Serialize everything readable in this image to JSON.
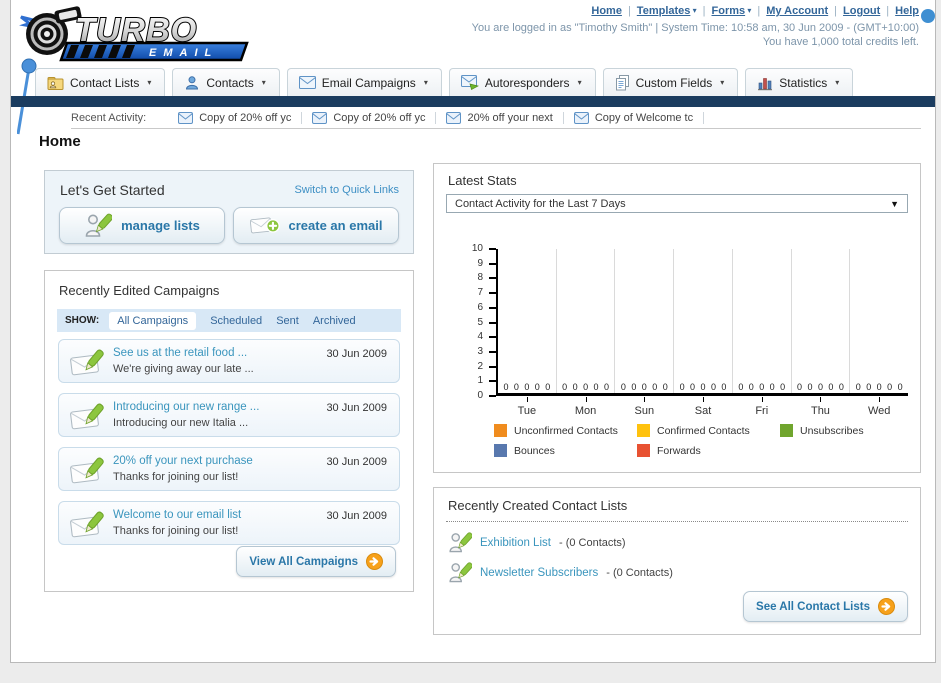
{
  "colors": {
    "navy_bar": "#1b3c5f",
    "link_blue": "#336699",
    "teal_link": "#3a95bd",
    "accent_orange": "#f7a11a"
  },
  "header": {
    "logo_title": "TURBO",
    "logo_subtitle": "EMAIL",
    "nav_links": [
      {
        "label": "Home",
        "caret": false
      },
      {
        "label": "Templates",
        "caret": true
      },
      {
        "label": "Forms",
        "caret": true
      },
      {
        "label": "My Account",
        "caret": false
      },
      {
        "label": "Logout",
        "caret": false
      },
      {
        "label": "Help",
        "caret": false
      }
    ],
    "login_line": "You are logged in as \"Timothy Smith\" | System Time: 10:58 am, 30 Jun 2009 - (GMT+10:00)",
    "credits_line": "You have 1,000 total credits left."
  },
  "tabs": [
    {
      "label": "Contact Lists",
      "icon": "contact-lists-icon"
    },
    {
      "label": "Contacts",
      "icon": "contacts-icon"
    },
    {
      "label": "Email Campaigns",
      "icon": "email-campaigns-icon"
    },
    {
      "label": "Autoresponders",
      "icon": "autoresponders-icon"
    },
    {
      "label": "Custom Fields",
      "icon": "custom-fields-icon"
    },
    {
      "label": "Statistics",
      "icon": "statistics-icon"
    }
  ],
  "recent_activity": {
    "label": "Recent Activity:",
    "items": [
      "Copy of 20% off yc",
      "Copy of 20% off yc",
      "20% off your next",
      "Copy of Welcome tc"
    ]
  },
  "page_title": "Home",
  "get_started": {
    "title": "Let's Get Started",
    "switch_link": "Switch to Quick Links",
    "buttons": [
      {
        "label": "manage lists",
        "icon": "person-pencil-icon"
      },
      {
        "label": "create an email",
        "icon": "envelope-plus-icon"
      }
    ]
  },
  "campaigns": {
    "title": "Recently Edited Campaigns",
    "show_label": "SHOW:",
    "filters": [
      "All Campaigns",
      "Scheduled",
      "Sent",
      "Archived"
    ],
    "active_filter": "All Campaigns",
    "items": [
      {
        "title": "See us at the retail food ...",
        "subtitle": "We're giving away our late ...",
        "date": "30 Jun 2009"
      },
      {
        "title": "Introducing our new range ...",
        "subtitle": "Introducing our new Italia ...",
        "date": "30 Jun 2009"
      },
      {
        "title": "20% off your next purchase",
        "subtitle": "Thanks for joining our list!",
        "date": "30 Jun 2009"
      },
      {
        "title": "Welcome to our email list",
        "subtitle": "Thanks for joining our list!",
        "date": "30 Jun 2009"
      }
    ],
    "view_all_label": "View All Campaigns"
  },
  "latest_stats": {
    "title": "Latest Stats",
    "dropdown_value": "Contact Activity for the Last 7 Days",
    "chart_data": {
      "type": "bar",
      "title": "Contact Activity for the Last 7 Days",
      "categories": [
        "Tue",
        "Mon",
        "Sun",
        "Sat",
        "Fri",
        "Thu",
        "Wed"
      ],
      "series": [
        {
          "name": "Unconfirmed Contacts",
          "color": "#F08C1E",
          "values": [
            0,
            0,
            0,
            0,
            0,
            0,
            0
          ]
        },
        {
          "name": "Confirmed Contacts",
          "color": "#FFC20E",
          "values": [
            0,
            0,
            0,
            0,
            0,
            0,
            0
          ]
        },
        {
          "name": "Unsubscribes",
          "color": "#70A52E",
          "values": [
            0,
            0,
            0,
            0,
            0,
            0,
            0
          ]
        },
        {
          "name": "Bounces",
          "color": "#5878AE",
          "values": [
            0,
            0,
            0,
            0,
            0,
            0,
            0
          ]
        },
        {
          "name": "Forwards",
          "color": "#E85232",
          "values": [
            0,
            0,
            0,
            0,
            0,
            0,
            0
          ]
        }
      ],
      "ylim": [
        0,
        10
      ],
      "ytick_step": 1,
      "grid": "vertical",
      "legend_position": "bottom",
      "data_labels": "each bar labeled with its value (all 0)"
    }
  },
  "contact_lists": {
    "title": "Recently Created Contact Lists",
    "items": [
      {
        "name": "Exhibition List",
        "count": "- (0 Contacts)",
        "icon": "person-pencil-icon"
      },
      {
        "name": "Newsletter Subscribers",
        "count": "- (0 Contacts)",
        "icon": "person-pencil-icon"
      }
    ],
    "see_all_label": "See All Contact Lists"
  }
}
